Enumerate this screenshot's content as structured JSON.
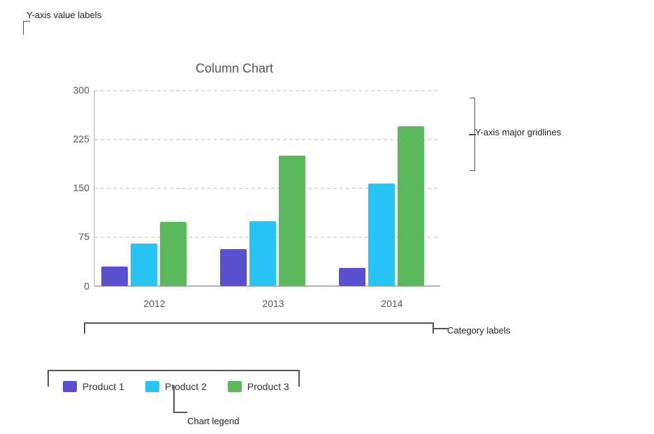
{
  "chart": {
    "title": "Column Chart",
    "y_axis_label": "Y-axis value labels",
    "y_axis_major_label": "Y-axis major gridlines",
    "category_labels_label": "Category labels",
    "chart_legend_label": "Chart legend",
    "y_labels": [
      "0",
      "75",
      "150",
      "225",
      "300"
    ],
    "categories": [
      "2012",
      "2013",
      "2014"
    ],
    "series": [
      {
        "name": "Product 1",
        "color": "#5a4fcf",
        "class": "bar-p1",
        "values": [
          30,
          60,
          28
        ]
      },
      {
        "name": "Product 2",
        "color": "#26c5f3",
        "class": "bar-p2",
        "values": [
          65,
          100,
          157
        ]
      },
      {
        "name": "Product 3",
        "color": "#5cb85c",
        "class": "bar-p3",
        "values": [
          105,
          200,
          245
        ]
      }
    ],
    "max_value": 300
  }
}
